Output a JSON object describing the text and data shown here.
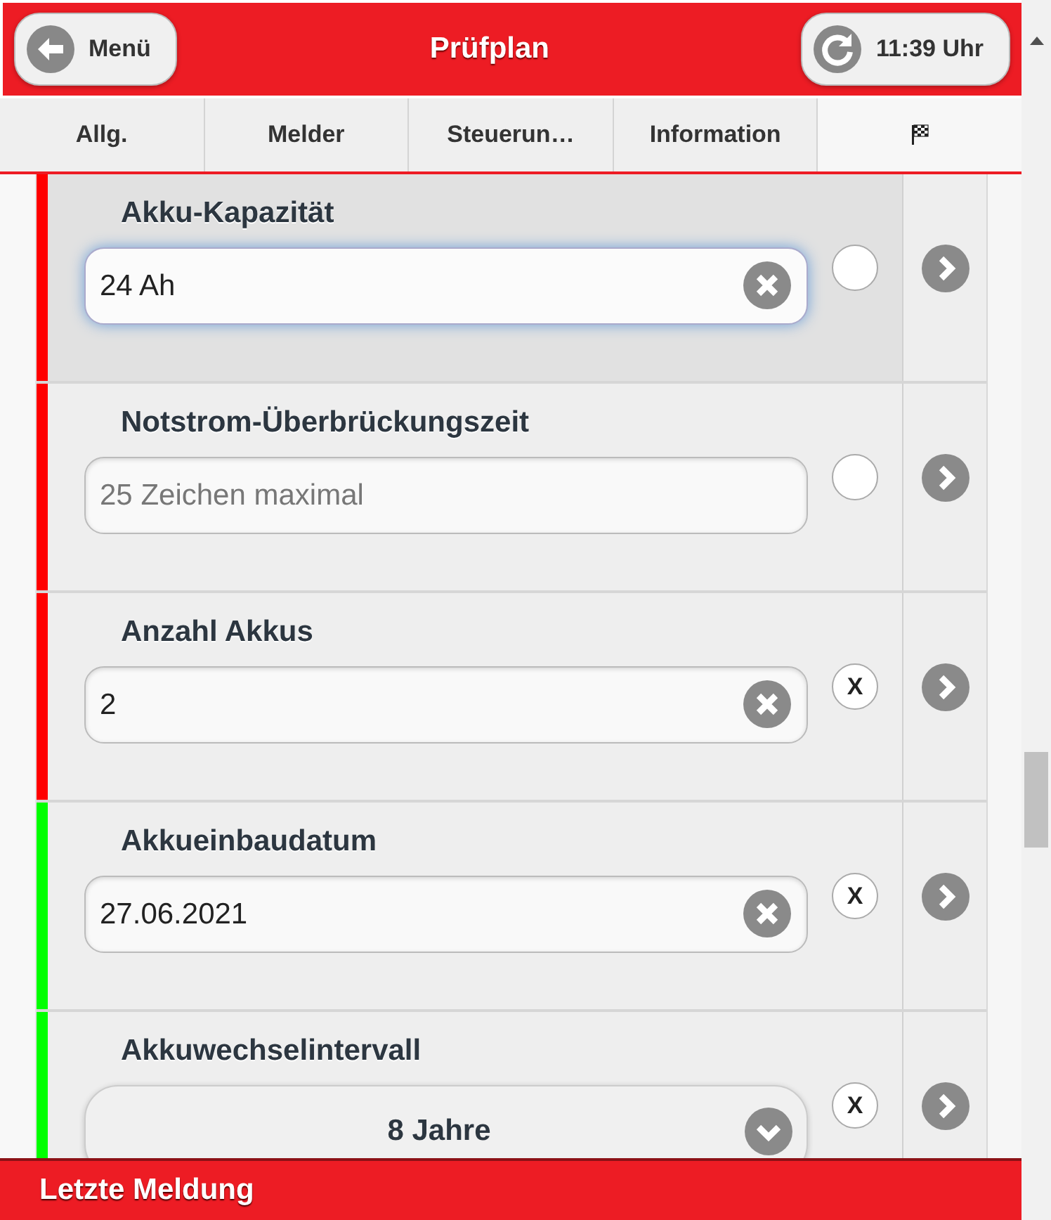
{
  "header": {
    "back_button": "Menü",
    "title": "Prüfplan",
    "refresh_button": "11:39 Uhr"
  },
  "tabs": [
    {
      "kind": "text",
      "label": "Allg.",
      "selected": false
    },
    {
      "kind": "text",
      "label": "Melder",
      "selected": false
    },
    {
      "kind": "text",
      "label": "Steuerun…",
      "selected": false
    },
    {
      "kind": "text",
      "label": "Information",
      "selected": false
    },
    {
      "kind": "flag",
      "selected": true
    }
  ],
  "rows": [
    {
      "kind": "text",
      "label": "Akku-Kapazität",
      "value": "24 Ah",
      "color": "#ff0000",
      "focused": true
    },
    {
      "kind": "text",
      "label": "Notstrom-Überbrückungszeit",
      "placeholder": "25 Zeichen maximal",
      "color": "#ff0000",
      "focused": false
    },
    {
      "kind": "text",
      "label": "Anzahl Akkus",
      "value": "2",
      "color": "#ff0000",
      "focused": false,
      "mark": "X"
    },
    {
      "kind": "text",
      "label": "Akkueinbaudatum",
      "value": "27.06.2021",
      "color": "#00ff00",
      "focused": false,
      "mark": "X"
    },
    {
      "kind": "select",
      "label": "Akkuwechselintervall",
      "value": "8 Jahre",
      "color": "#00ff00",
      "focused": false,
      "mark": "X"
    }
  ],
  "footer": {
    "title": "Letzte Meldung"
  }
}
